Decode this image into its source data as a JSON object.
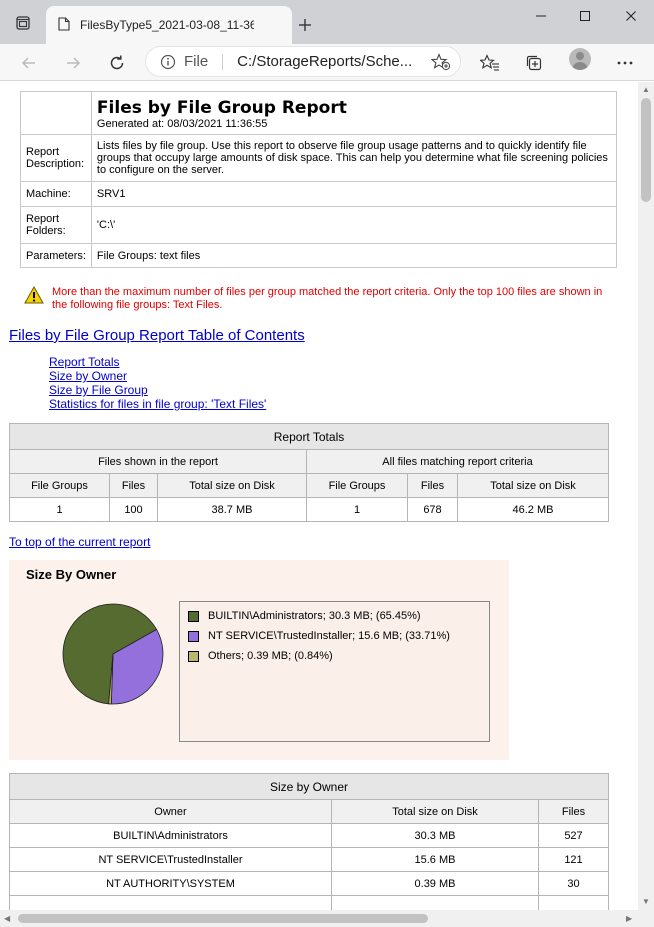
{
  "browser": {
    "tab_title": "FilesByType5_2021-03-08_11-36-",
    "address_scheme": "File",
    "address_url": "C:/StorageReports/Sche..."
  },
  "report": {
    "title": "Files by File Group Report",
    "generated": "Generated at: 08/03/2021 11:36:55",
    "rows": [
      {
        "label": "Report Description:",
        "value": "Lists files by file group. Use this report to observe file group usage patterns and to quickly identify file groups that occupy large amounts of disk space. This can help you determine what file screening policies to configure on the server."
      },
      {
        "label": "Machine:",
        "value": "SRV1"
      },
      {
        "label": "Report Folders:",
        "value": "'C:\\'"
      },
      {
        "label": "Parameters:",
        "value": "File Groups: text files"
      }
    ]
  },
  "warning": {
    "text": "More than the maximum number of files per group matched the report criteria. Only the top 100 files are shown in the following file groups: Text Files."
  },
  "toc": {
    "title": "Files by File Group Report Table of Contents",
    "links": [
      "Report Totals",
      "Size by Owner",
      "Size by File Group",
      "Statistics for files in file group: 'Text Files'"
    ]
  },
  "totals": {
    "caption": "Report Totals",
    "group_left": "Files shown in the report",
    "group_right": "All files matching report criteria",
    "columns": [
      "File Groups",
      "Files",
      "Total size on Disk",
      "File Groups",
      "Files",
      "Total size on Disk"
    ],
    "row": [
      "1",
      "100",
      "38.7 MB",
      "1",
      "678",
      "46.2 MB"
    ]
  },
  "top_link": "To top of the current report",
  "chart_data": {
    "type": "pie",
    "title": "Size By Owner",
    "slices": [
      {
        "label": "BUILTIN\\Administrators; 30.3 MB; (65.45%)",
        "value": 65.45,
        "color": "#556b2f"
      },
      {
        "label": "NT SERVICE\\TrustedInstaller; 15.6 MB; (33.71%)",
        "value": 33.71,
        "color": "#9370db"
      },
      {
        "label": "Others; 0.39 MB; (0.84%)",
        "value": 0.84,
        "color": "#bdb76b"
      }
    ],
    "legend": "right"
  },
  "owner_table": {
    "caption": "Size by Owner",
    "columns": [
      "Owner",
      "Total size on Disk",
      "Files"
    ],
    "rows": [
      [
        "BUILTIN\\Administrators",
        "30.3 MB",
        "527"
      ],
      [
        "NT SERVICE\\TrustedInstaller",
        "15.6 MB",
        "121"
      ],
      [
        "NT AUTHORITY\\SYSTEM",
        "0.39 MB",
        "30"
      ]
    ]
  }
}
